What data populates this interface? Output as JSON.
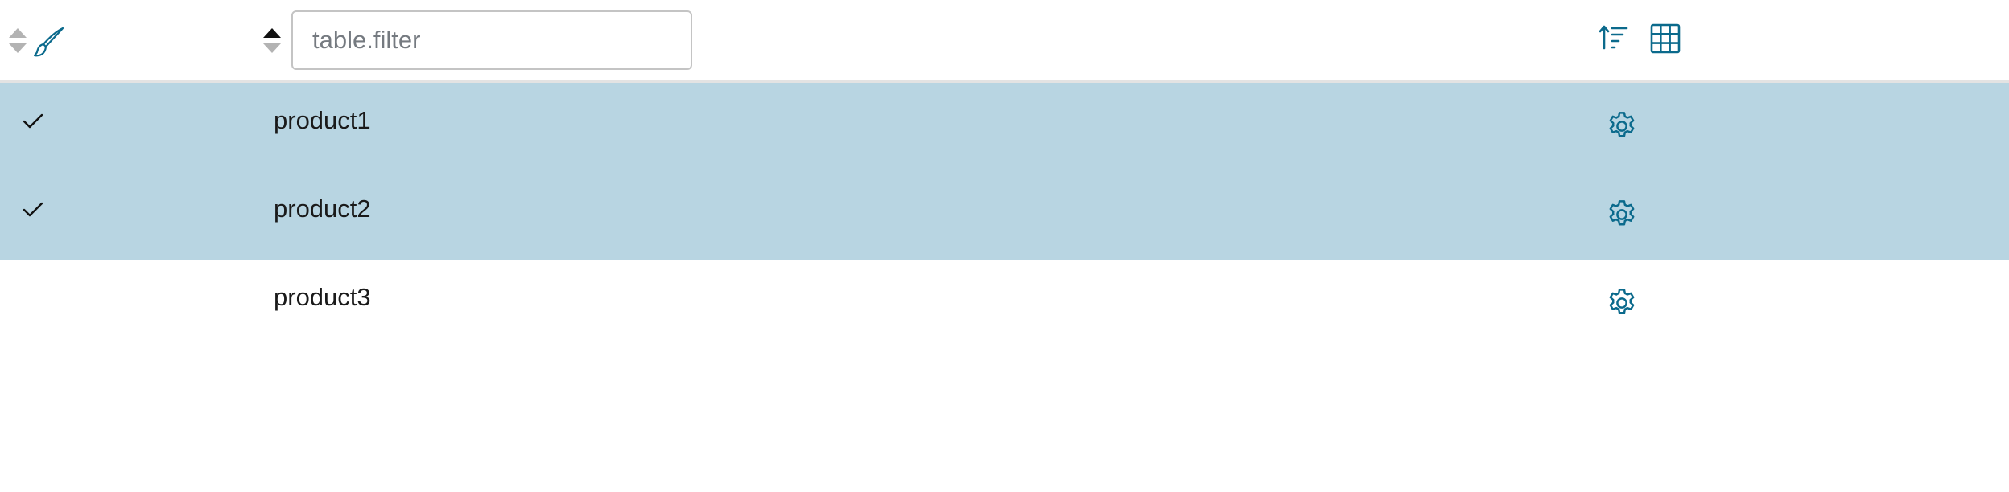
{
  "header": {
    "filter": {
      "placeholder": "table.filter",
      "value": ""
    },
    "selection_sort_state": "unsorted",
    "name_sort_state": "ascending"
  },
  "rows": [
    {
      "label": "product1",
      "selected": true
    },
    {
      "label": "product2",
      "selected": true
    },
    {
      "label": "product3",
      "selected": false
    }
  ],
  "icons": {
    "selection_sort": "sort-arrows-icon",
    "clear_selection": "paintbrush-icon",
    "name_sort": "sort-arrows-icon",
    "sort_options": "sort-list-icon",
    "column_chooser": "grid-table-icon",
    "row_settings": "gear-icon",
    "row_check": "checkmark-icon"
  },
  "colors": {
    "selected_row_bg": "#b8d5e2",
    "accent_icon": "#0b6a8c",
    "header_divider": "#e3e3e3",
    "sort_inactive": "#b3b3b3",
    "sort_active": "#111111"
  }
}
